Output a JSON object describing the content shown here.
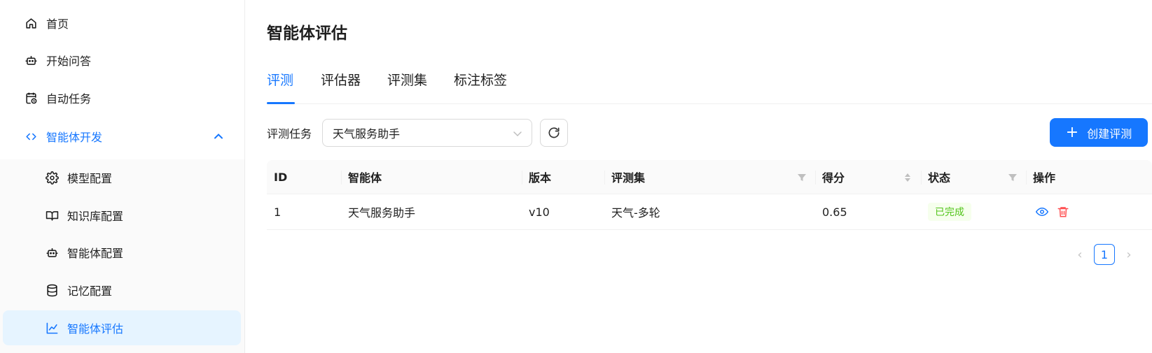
{
  "sidebar": {
    "items": [
      {
        "label": "首页",
        "icon": "home-icon"
      },
      {
        "label": "开始问答",
        "icon": "robot-icon"
      },
      {
        "label": "自动任务",
        "icon": "calendar-clock-icon"
      },
      {
        "label": "智能体开发",
        "icon": "code-icon"
      },
      {
        "label": "模型配置",
        "icon": "gear-icon"
      },
      {
        "label": "知识库配置",
        "icon": "book-icon"
      },
      {
        "label": "智能体配置",
        "icon": "robot-icon"
      },
      {
        "label": "记忆配置",
        "icon": "database-icon"
      },
      {
        "label": "智能体评估",
        "icon": "line-chart-icon"
      }
    ]
  },
  "page": {
    "title": "智能体评估"
  },
  "tabs": [
    "评测",
    "评估器",
    "评测集",
    "标注标签"
  ],
  "filter": {
    "label": "评测任务",
    "selected": "天气服务助手"
  },
  "create_button": {
    "label": "创建评测"
  },
  "table": {
    "columns": [
      "ID",
      "智能体",
      "版本",
      "评测集",
      "得分",
      "状态",
      "操作"
    ],
    "rows": [
      {
        "id": "1",
        "agent": "天气服务助手",
        "version": "v10",
        "set": "天气-多轮",
        "score": "0.65",
        "status": "已完成"
      }
    ]
  },
  "pagination": {
    "current": "1"
  },
  "colors": {
    "primary": "#1677ff",
    "success": "#52c41a",
    "danger": "#ff4d4f"
  }
}
